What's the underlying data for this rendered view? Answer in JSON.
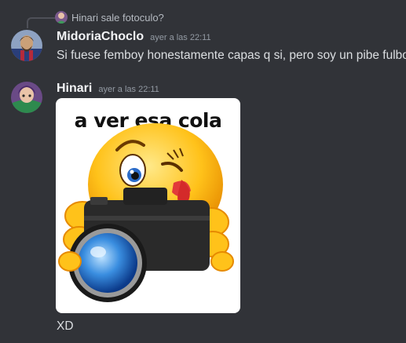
{
  "reply": {
    "author": "Hinari",
    "snippet": "Hinari sale fotoculo?"
  },
  "messages": [
    {
      "author": "MidoriaChoclo",
      "timestamp": "ayer a las 22:11",
      "text": "Si fuese femboy honestamente capas q si, pero soy un pibe fulbo"
    },
    {
      "author": "Hinari",
      "timestamp": "ayer a las 22:11",
      "image_caption": "a ver esa cola",
      "text": "XD"
    }
  ],
  "colors": {
    "background": "#313338",
    "username": "#f2f3f5",
    "text": "#dbdee1",
    "muted": "#949ba4"
  }
}
